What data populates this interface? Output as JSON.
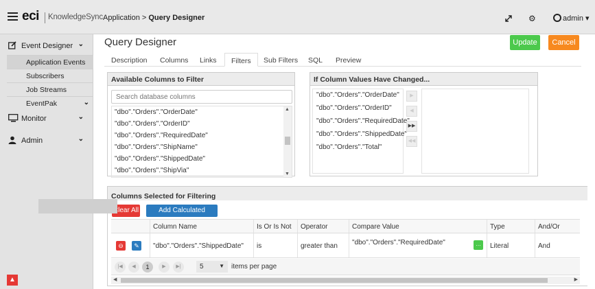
{
  "header": {
    "logo_brand": "eci",
    "logo_product": "KnowledgeSync",
    "breadcrumb_app": "Application",
    "breadcrumb_sep": " > ",
    "breadcrumb_page": "Query Designer",
    "user": "admin"
  },
  "sidebar": {
    "event_designer": "Event Designer",
    "items": [
      {
        "label": "Application Events"
      },
      {
        "label": "Subscribers"
      },
      {
        "label": "Job Streams"
      },
      {
        "label": "EventPak"
      }
    ],
    "monitor": "Monitor",
    "admin": "Admin"
  },
  "page": {
    "title": "Query Designer",
    "update": "Update",
    "cancel": "Cancel",
    "tabs": [
      {
        "label": "Description"
      },
      {
        "label": "Columns"
      },
      {
        "label": "Links"
      },
      {
        "label": "Filters"
      },
      {
        "label": "Sub Filters"
      },
      {
        "label": "SQL"
      },
      {
        "label": "Preview"
      }
    ]
  },
  "available": {
    "title": "Available Columns to Filter",
    "search_placeholder": "Search database columns",
    "items": [
      "\"dbo\".\"Orders\".\"OrderDate\"",
      "\"dbo\".\"Orders\".\"OrderID\"",
      "\"dbo\".\"Orders\".\"RequiredDate\"",
      "\"dbo\".\"Orders\".\"ShipName\"",
      "\"dbo\".\"Orders\".\"ShippedDate\"",
      "\"dbo\".\"Orders\".\"ShipVia\""
    ]
  },
  "changed": {
    "title": "If Column Values Have Changed...",
    "items": [
      "\"dbo\".\"Orders\".\"OrderDate\"",
      "\"dbo\".\"Orders\".\"OrderID\"",
      "\"dbo\".\"Orders\".\"RequiredDate\"",
      "\"dbo\".\"Orders\".\"ShippedDate\"",
      "\"dbo\".\"Orders\".\"Total\""
    ]
  },
  "selected": {
    "title": "Columns Selected for Filtering",
    "clear_all": "Clear All",
    "add_calc": "Add Calculated Column",
    "headers": [
      "Column Name",
      "Is Or Is Not",
      "Operator",
      "Compare Value",
      "Type",
      "And/Or"
    ],
    "row": {
      "column_name": "\"dbo\".\"Orders\".\"ShippedDate\"",
      "is_or_is_not": "is",
      "operator": "greater than",
      "compare_value": "\"dbo\".\"Orders\".\"RequiredDate\"",
      "type": "Literal",
      "and_or": "And"
    },
    "pager": {
      "current_page": "1",
      "page_size": "5",
      "items_per_page": "items per page"
    }
  },
  "colors": {
    "update_green": "#4cc94c",
    "cancel_orange": "#f7891f",
    "clear_red": "#e53935",
    "calc_blue": "#2b7bbf"
  }
}
